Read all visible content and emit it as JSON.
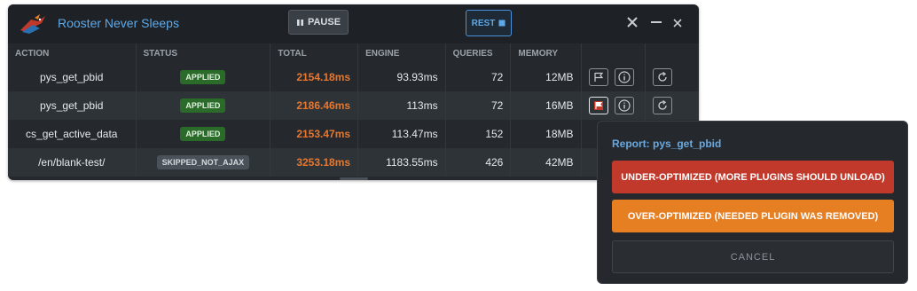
{
  "header": {
    "title": "Rooster Never Sleeps",
    "pause_label": "PAUSE",
    "rest_label": "REST"
  },
  "table": {
    "columns": [
      "ACTION",
      "STATUS",
      "TOTAL",
      "ENGINE",
      "QUERIES",
      "MEMORY"
    ],
    "rows": [
      {
        "action": "pys_get_pbid",
        "status": "APPLIED",
        "total": "2154.18ms",
        "engine": "93.93ms",
        "queries": "72",
        "memory": "12MB"
      },
      {
        "action": "pys_get_pbid",
        "status": "APPLIED",
        "total": "2186.46ms",
        "engine": "113ms",
        "queries": "72",
        "memory": "16MB"
      },
      {
        "action": "cs_get_active_data",
        "status": "APPLIED",
        "total": "2153.47ms",
        "engine": "113.47ms",
        "queries": "152",
        "memory": "18MB"
      },
      {
        "action": "/en/blank-test/",
        "status": "SKIPPED_NOT_AJAX",
        "total": "3253.18ms",
        "engine": "1183.55ms",
        "queries": "426",
        "memory": "42MB"
      }
    ]
  },
  "report": {
    "title": "Report: pys_get_pbid",
    "under_label": "UNDER-OPTIMIZED (MORE PLUGINS SHOULD UNLOAD)",
    "over_label": "OVER-OPTIMIZED (NEEDED PLUGIN WAS REMOVED)",
    "cancel_label": "CANCEL"
  },
  "colors": {
    "accent": "#5fa8e6",
    "total_text": "#e8772e",
    "applied_badge": "#2a6b2a",
    "skipped_badge": "#4a5158",
    "under_button": "#c0392b",
    "over_button": "#e67e22"
  }
}
